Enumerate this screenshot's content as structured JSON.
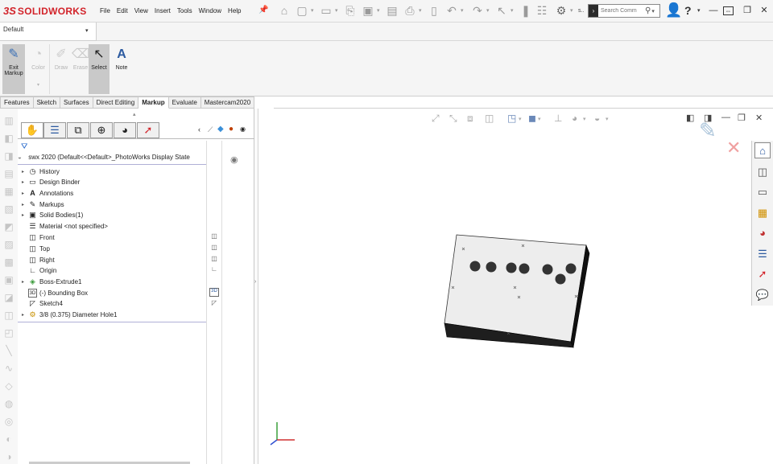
{
  "app": {
    "logo_ds": "3S",
    "logo_name": "SOLIDWORKS"
  },
  "menus": [
    "File",
    "Edit",
    "View",
    "Insert",
    "Tools",
    "Window",
    "Help"
  ],
  "search": {
    "placeholder": "Search Comm"
  },
  "quick_access": {
    "settings_label": "s.."
  },
  "config": {
    "value": "Default"
  },
  "ribbon": {
    "exit_markup": "Exit Markup",
    "color": "Color",
    "draw": "Draw",
    "erase": "Erase",
    "select": "Select",
    "note": "Note"
  },
  "tabs": [
    {
      "label": "Features"
    },
    {
      "label": "Sketch"
    },
    {
      "label": "Surfaces"
    },
    {
      "label": "Direct Editing"
    },
    {
      "label": "Markup",
      "active": true
    },
    {
      "label": "Evaluate"
    },
    {
      "label": "Mastercam2020"
    }
  ],
  "tree": {
    "root": "swx 2020  (Default<<Default>_PhotoWorks Display State",
    "items": [
      {
        "label": "History",
        "icon": "history-icon",
        "expandable": true
      },
      {
        "label": "Design Binder",
        "icon": "design-binder-icon",
        "expandable": true
      },
      {
        "label": "Annotations",
        "icon": "annotations-icon",
        "expandable": true
      },
      {
        "label": "Markups",
        "icon": "markups-icon",
        "expandable": true
      },
      {
        "label": "Solid Bodies(1)",
        "icon": "solid-bodies-icon",
        "expandable": true
      },
      {
        "label": "Material <not specified>",
        "icon": "material-icon",
        "expandable": false
      },
      {
        "label": "Front",
        "icon": "plane-icon",
        "expandable": false
      },
      {
        "label": "Top",
        "icon": "plane-icon",
        "expandable": false
      },
      {
        "label": "Right",
        "icon": "plane-icon",
        "expandable": false
      },
      {
        "label": "Origin",
        "icon": "origin-icon",
        "expandable": false
      },
      {
        "label": "Boss-Extrude1",
        "icon": "extrude-icon",
        "expandable": true
      },
      {
        "label": "(-) Bounding Box",
        "icon": "bounding-box-icon",
        "expandable": false
      },
      {
        "label": "Sketch4",
        "icon": "sketch-icon",
        "expandable": false
      },
      {
        "label": "3/8 (0.375) Diameter Hole1",
        "icon": "hole-icon",
        "expandable": true
      }
    ]
  },
  "colors": {
    "accent_red": "#d2232a",
    "tree_blue": "#1e63c9"
  }
}
